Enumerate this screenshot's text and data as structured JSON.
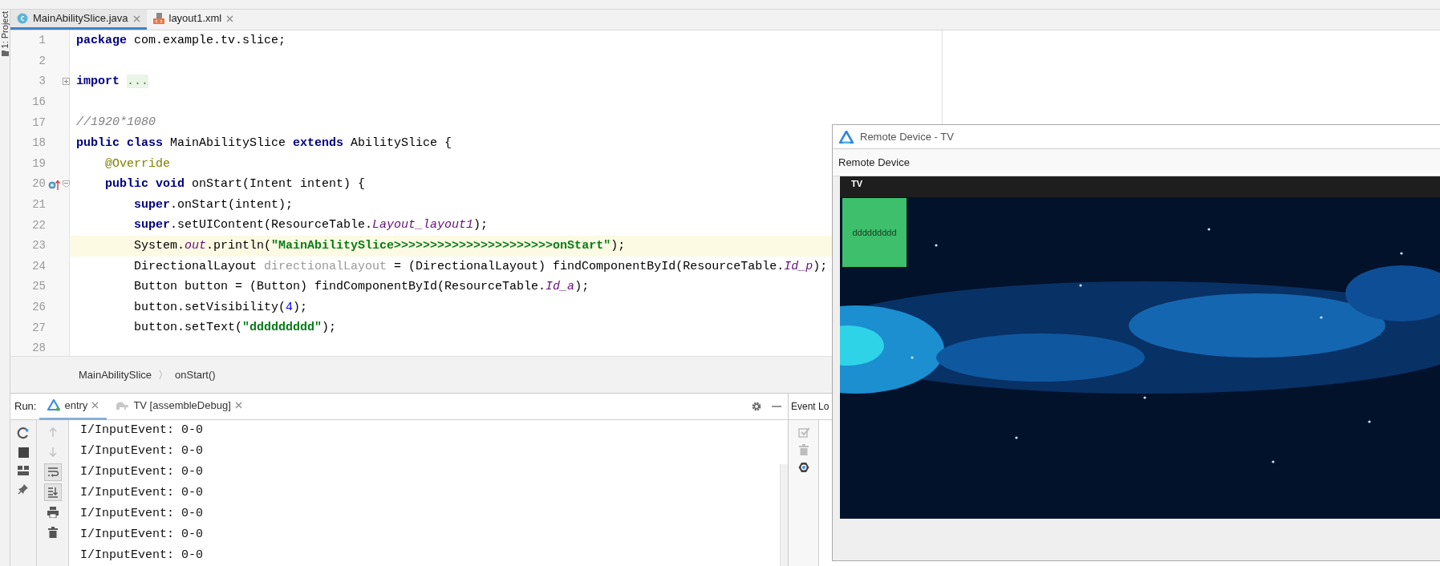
{
  "sidebar": {
    "label": "1: Project"
  },
  "editor_tabs": [
    {
      "label": "MainAbilitySlice.java",
      "kind": "java",
      "selected": true
    },
    {
      "label": "layout1.xml",
      "kind": "xml",
      "selected": false
    }
  ],
  "code": {
    "lines": [
      {
        "number": "1",
        "current": false,
        "tokens": [
          {
            "kind": "kw",
            "text": "package"
          },
          {
            "kind": "plain",
            "text": " com.example.tv.slice;"
          }
        ]
      },
      {
        "number": "2",
        "current": false
      },
      {
        "number": "3",
        "current": false,
        "folded": true,
        "tokens": [
          {
            "kind": "kw",
            "text": "import "
          },
          {
            "kind": "folded",
            "text": "..."
          }
        ]
      },
      {
        "number": "16",
        "current": false
      },
      {
        "number": "17",
        "current": false,
        "tokens": [
          {
            "kind": "comment",
            "text": "//1920*1080"
          }
        ]
      },
      {
        "number": "18",
        "current": false,
        "tokens": [
          {
            "kind": "kw",
            "text": "public class"
          },
          {
            "kind": "plain",
            "text": " MainAbilitySlice "
          },
          {
            "kind": "kw",
            "text": "extends"
          },
          {
            "kind": "plain",
            "text": " AbilitySlice {"
          }
        ]
      },
      {
        "number": "19",
        "current": false,
        "tokens": [
          {
            "kind": "annot",
            "text": "    @Override"
          }
        ]
      },
      {
        "number": "20",
        "current": false,
        "folded": false,
        "overrides": true,
        "tokens": [
          {
            "kind": "kw",
            "text": "    public void"
          },
          {
            "kind": "plain",
            "text": " onStart(Intent intent) {"
          }
        ]
      },
      {
        "number": "21",
        "current": false,
        "tokens": [
          {
            "kind": "kw",
            "text": "        super"
          },
          {
            "kind": "plain",
            "text": ".onStart(intent);"
          }
        ]
      },
      {
        "number": "22",
        "current": false,
        "tokens": [
          {
            "kind": "kw",
            "text": "        super"
          },
          {
            "kind": "plain",
            "text": ".setUIContent(ResourceTable."
          },
          {
            "kind": "static",
            "text": "Layout_layout1"
          },
          {
            "kind": "plain",
            "text": ");"
          }
        ]
      },
      {
        "number": "23",
        "current": true,
        "tokens": [
          {
            "kind": "plain",
            "text": "        System."
          },
          {
            "kind": "static",
            "text": "out"
          },
          {
            "kind": "plain",
            "text": ".println("
          },
          {
            "kind": "str",
            "text": "\"MainAbilitySlice>>>>>>>>>>>>>>>>>>>>>>onStart\""
          },
          {
            "kind": "plain",
            "text": ");"
          }
        ]
      },
      {
        "number": "24",
        "current": false,
        "tokens": [
          {
            "kind": "plain",
            "text": "        DirectionalLayout "
          },
          {
            "kind": "unused",
            "text": "directionalLayout"
          },
          {
            "kind": "plain",
            "text": " = (DirectionalLayout) findComponentById(ResourceTable."
          },
          {
            "kind": "static",
            "text": "Id_p"
          },
          {
            "kind": "plain",
            "text": ");"
          }
        ]
      },
      {
        "number": "25",
        "current": false,
        "tokens": [
          {
            "kind": "plain",
            "text": "        Button button = (Button) findComponentById(ResourceTable."
          },
          {
            "kind": "static",
            "text": "Id_a"
          },
          {
            "kind": "plain",
            "text": ");"
          }
        ]
      },
      {
        "number": "26",
        "current": false,
        "tokens": [
          {
            "kind": "plain",
            "text": "        button.setVisibility("
          },
          {
            "kind": "num",
            "text": "4"
          },
          {
            "kind": "plain",
            "text": ");"
          }
        ]
      },
      {
        "number": "27",
        "current": false,
        "tokens": [
          {
            "kind": "plain",
            "text": "        button.setText("
          },
          {
            "kind": "str",
            "text": "\"ddddddddd\""
          },
          {
            "kind": "plain",
            "text": ");"
          }
        ]
      },
      {
        "number": "28",
        "current": false
      }
    ]
  },
  "breadcrumb": {
    "items": [
      "MainAbilitySlice",
      "onStart()"
    ],
    "separator": "〉"
  },
  "run": {
    "label": "Run:",
    "tabs": [
      {
        "label": "entry",
        "kind": "harmony",
        "selected": true
      },
      {
        "label": "TV [assembleDebug]",
        "kind": "build",
        "selected": false
      }
    ],
    "toolbar": [
      {
        "kind": "up",
        "disabled": true,
        "on": false
      },
      {
        "kind": "down",
        "disabled": true,
        "on": false
      },
      {
        "kind": "wrap",
        "disabled": false,
        "on": true
      },
      {
        "kind": "scroll-end",
        "disabled": false,
        "on": true
      },
      {
        "kind": "print",
        "disabled": false,
        "on": false
      },
      {
        "kind": "trash",
        "disabled": false,
        "on": false
      }
    ],
    "log": [
      "I/InputEvent: 0-0",
      "I/InputEvent: 0-0",
      "I/InputEvent: 0-0",
      "I/InputEvent: 0-0",
      "I/InputEvent: 0-0",
      "I/InputEvent: 0-0",
      "I/InputEvent: 0-0"
    ]
  },
  "event_log": {
    "title": "Event Lo",
    "tools": [
      {
        "kind": "check",
        "disabled": true
      },
      {
        "kind": "trash",
        "disabled": true
      },
      {
        "kind": "gear",
        "disabled": false
      }
    ]
  },
  "remote_window": {
    "title": "Remote Device - TV",
    "menu": "Remote Device",
    "screen": {
      "header": "TV",
      "button": "ddddddddd"
    }
  }
}
